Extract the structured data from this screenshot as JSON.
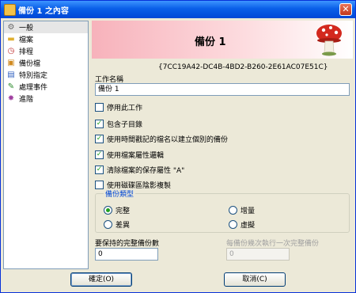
{
  "window": {
    "title": "備份 1 之內容",
    "close_symbol": "✕"
  },
  "sidebar": {
    "items": [
      {
        "label": "一般",
        "icon": "gear-icon",
        "glyph": "⚙",
        "selected": true
      },
      {
        "label": "檔案",
        "icon": "folder-icon",
        "glyph": "▬"
      },
      {
        "label": "排程",
        "icon": "clock-icon",
        "glyph": "◷"
      },
      {
        "label": "備份檔",
        "icon": "archive-icon",
        "glyph": "▣"
      },
      {
        "label": "特別指定",
        "icon": "filter-icon",
        "glyph": "▤"
      },
      {
        "label": "處理事件",
        "icon": "event-icon",
        "glyph": "✎"
      },
      {
        "label": "進階",
        "icon": "advanced-icon",
        "glyph": "✸"
      }
    ]
  },
  "header": {
    "title": "備份 1"
  },
  "guid": "{7CC19A42-DC4B-4BD2-B260-2E61AC07E51C}",
  "job_name": {
    "label": "工作名稱",
    "value": "備份 1"
  },
  "options": [
    {
      "label": "停用此工作",
      "checked": false
    },
    {
      "label": "包含子目錄",
      "checked": true
    },
    {
      "label": "使用時間戳記的檔名以建立個別的備份",
      "checked": true
    },
    {
      "label": "使用檔案屬性邏輯",
      "checked": true
    },
    {
      "label": "清除檔案的保存屬性 \"A\"",
      "checked": true
    },
    {
      "label": "使用磁碟區陰影複製",
      "checked": false
    }
  ],
  "backup_type": {
    "title": "備份類型",
    "options": [
      {
        "label": "完整",
        "selected": true
      },
      {
        "label": "增量",
        "selected": false
      },
      {
        "label": "差異",
        "selected": false
      },
      {
        "label": "虛擬",
        "selected": false
      }
    ]
  },
  "keep_full": {
    "label": "要保持的完整備份數",
    "value": "0"
  },
  "full_every": {
    "label": "每備份幾次執行一次完整備份",
    "value": "0"
  },
  "buttons": {
    "ok": "確定(O)",
    "cancel": "取消(C)"
  },
  "colors": {
    "titlebar": "#0a5fe8",
    "accent": "#0046d5",
    "check": "#21a121"
  }
}
